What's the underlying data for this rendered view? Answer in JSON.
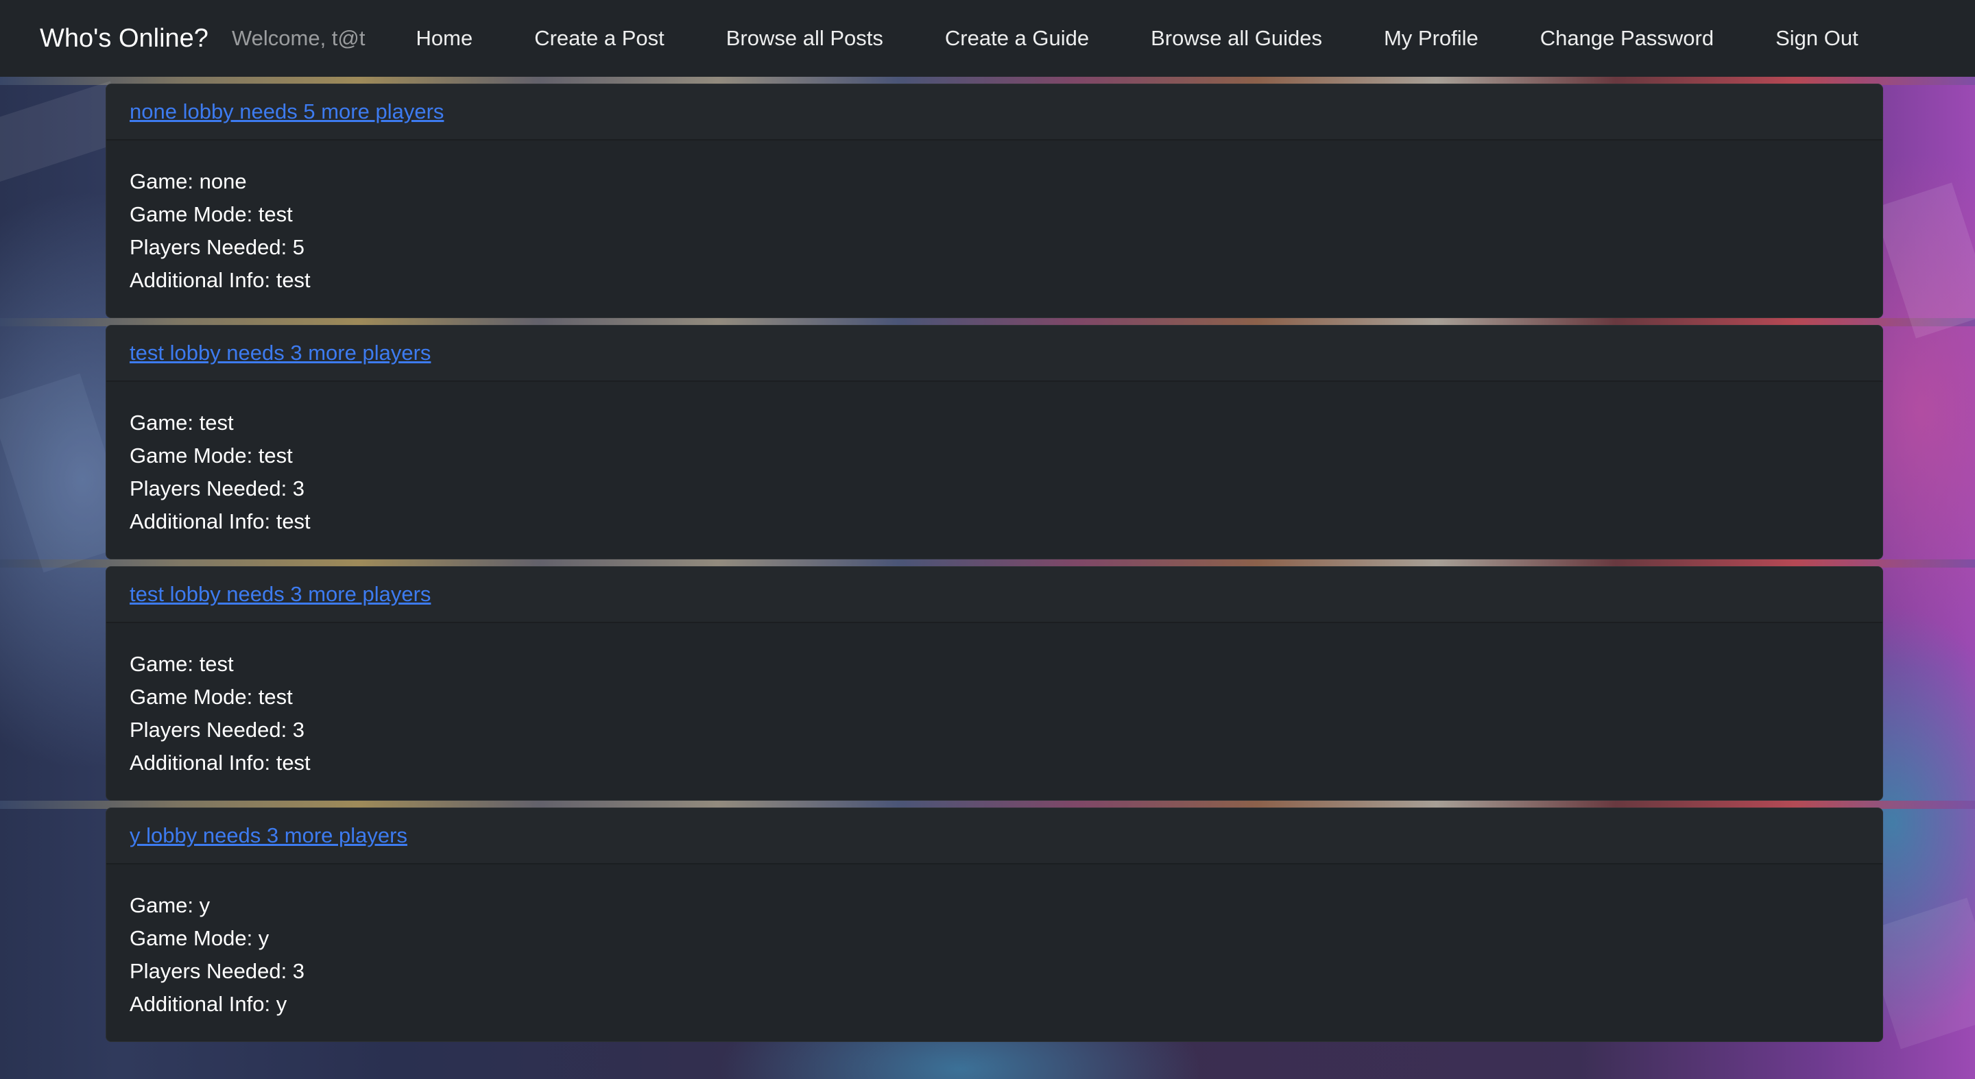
{
  "navbar": {
    "brand": "Who's Online?",
    "welcome": "Welcome, t@t",
    "links": [
      {
        "label": "Home"
      },
      {
        "label": "Create a Post"
      },
      {
        "label": "Browse all Posts"
      },
      {
        "label": "Create a Guide"
      },
      {
        "label": "Browse all Guides"
      },
      {
        "label": "My Profile"
      },
      {
        "label": "Change Password"
      },
      {
        "label": "Sign Out"
      }
    ]
  },
  "posts": [
    {
      "title": "none lobby needs 5 more players",
      "game": "Game: none",
      "mode": "Game Mode: test",
      "players": "Players Needed: 5",
      "info": "Additional Info: test"
    },
    {
      "title": "test lobby needs 3 more players",
      "game": "Game: test",
      "mode": "Game Mode: test",
      "players": "Players Needed: 3",
      "info": "Additional Info: test"
    },
    {
      "title": "test lobby needs 3 more players",
      "game": "Game: test",
      "mode": "Game Mode: test",
      "players": "Players Needed: 3",
      "info": "Additional Info: test"
    },
    {
      "title": "y lobby needs 3 more players",
      "game": "Game: y",
      "mode": "Game Mode: y",
      "players": "Players Needed: 3",
      "info": "Additional Info: y"
    }
  ],
  "colors": {
    "navbar_bg": "#212529",
    "card_bg": "#212529",
    "link": "#3d7bf0",
    "text": "#ffffff"
  }
}
